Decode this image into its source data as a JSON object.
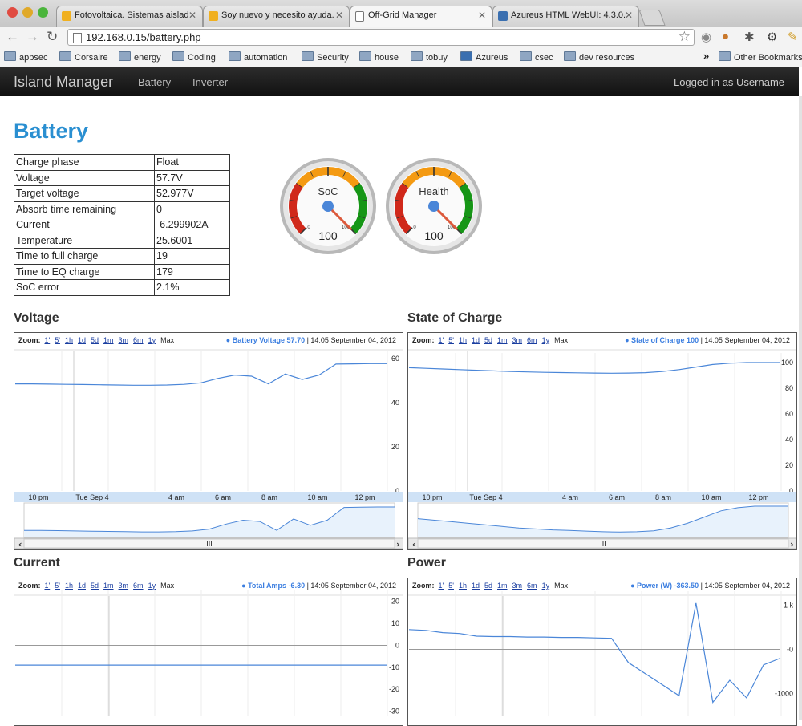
{
  "browser": {
    "tabs": [
      {
        "title": "Fotovoltaica. Sistemas aislad",
        "favicon_color": "#f0b020",
        "active": false
      },
      {
        "title": "Soy nuevo y necesito ayuda.",
        "favicon_color": "#f0b020",
        "active": false
      },
      {
        "title": "Off-Grid Manager",
        "favicon_color": "",
        "active": true
      },
      {
        "title": "Azureus HTML WebUI: 4.3.0.",
        "favicon_color": "#3a6fb0",
        "active": false
      }
    ],
    "url": "192.168.0.15/battery.php",
    "bookmarks": [
      "appsec",
      "Corsaire",
      "energy",
      "Coding",
      "automation",
      "Security",
      "house",
      "tobuy",
      "Azureus",
      "csec",
      "dev resources"
    ],
    "other_bookmarks": "Other Bookmarks",
    "overflow": "»"
  },
  "nav": {
    "brand": "Island Manager",
    "links": [
      "Battery",
      "Inverter"
    ],
    "login": "Logged in as Username"
  },
  "page": {
    "title": "Battery",
    "table": [
      {
        "label": "Charge phase",
        "value": "Float"
      },
      {
        "label": "Voltage",
        "value": "57.7V"
      },
      {
        "label": "Target voltage",
        "value": "52.977V"
      },
      {
        "label": "Absorb time remaining",
        "value": "0"
      },
      {
        "label": "Current",
        "value": "-6.299902A"
      },
      {
        "label": "Temperature",
        "value": "25.6001"
      },
      {
        "label": "Time to full charge",
        "value": "19"
      },
      {
        "label": "Time to EQ charge",
        "value": "179"
      },
      {
        "label": "SoC error",
        "value": "2.1%"
      }
    ]
  },
  "gauges": [
    {
      "label": "SoC",
      "value": 100,
      "min_label": "0",
      "max_label": "100",
      "colors": {
        "low": "#d0281a",
        "mid": "#f49a12",
        "high": "#169616"
      }
    },
    {
      "label": "Health",
      "value": 100,
      "min_label": "0",
      "max_label": "100",
      "colors": {
        "low": "#d0281a",
        "mid": "#f49a12",
        "high": "#169616"
      }
    }
  ],
  "charts": {
    "zoom_label": "Zoom:",
    "zoom_options": [
      "1'",
      "5'",
      "1h",
      "1d",
      "5d",
      "1m",
      "3m",
      "6m",
      "1y",
      "Max"
    ],
    "timestamp": "14:05 September 04, 2012",
    "x_ticks": [
      "10 pm",
      "Tue Sep 4",
      "4 am",
      "6 am",
      "8 am",
      "10 am",
      "12 pm"
    ],
    "scroll_thumb": "III"
  },
  "chart_data": [
    {
      "type": "line",
      "title": "Voltage",
      "series": [
        {
          "name": "Battery Voltage",
          "values": [
            48.5,
            48.5,
            48.4,
            48.3,
            48.2,
            48.1,
            48.0,
            47.9,
            47.9,
            48.0,
            48.3,
            49.0,
            51.0,
            52.5,
            52.0,
            48.5,
            53.0,
            50.5,
            52.5,
            57.5,
            57.6,
            57.7,
            57.7
          ]
        }
      ],
      "legend_text": "Battery Voltage 57.70",
      "yticks": [
        0,
        20,
        40,
        60
      ],
      "ylim": [
        0,
        60
      ],
      "color": "#4a86d8"
    },
    {
      "type": "line",
      "title": "State of Charge",
      "series": [
        {
          "name": "State of Charge",
          "values": [
            96,
            95.5,
            95,
            94.5,
            94,
            93.5,
            93,
            92.7,
            92.4,
            92.2,
            92.0,
            91.8,
            91.7,
            91.8,
            92.1,
            93.0,
            94.5,
            96.5,
            98.5,
            99.5,
            100,
            100,
            100
          ]
        }
      ],
      "legend_text": "State of Charge 100",
      "yticks": [
        0,
        20,
        40,
        60,
        80,
        100
      ],
      "ylim": [
        0,
        100
      ],
      "color": "#4a86d8"
    },
    {
      "type": "line",
      "title": "Current",
      "series": [
        {
          "name": "Total Amps",
          "values": [
            -9,
            -9,
            -9,
            -9,
            -9,
            -9,
            -9,
            -9,
            -9,
            -9,
            -9,
            -9,
            -9,
            -9,
            -9,
            -9,
            -9,
            -9,
            -9,
            -9,
            -9,
            -9,
            -9
          ]
        }
      ],
      "legend_text": "Total Amps -6.30",
      "yticks": [
        20,
        10,
        0,
        -10,
        -20,
        -30
      ],
      "ylim": [
        -32,
        21
      ],
      "color": "#4a86d8"
    },
    {
      "type": "line",
      "title": "Power",
      "series": [
        {
          "name": "Power (W)",
          "values": [
            450,
            430,
            380,
            360,
            300,
            290,
            290,
            280,
            280,
            270,
            270,
            260,
            250,
            -300,
            -550,
            -800,
            -1050,
            1050,
            -1200,
            -700,
            -1100,
            -350,
            -200
          ]
        }
      ],
      "legend_text": "Power (W) -363.50",
      "yticks": [
        "1 k",
        "-0",
        "-1000"
      ],
      "ylim": [
        -1500,
        1100
      ],
      "color": "#4a86d8"
    }
  ]
}
